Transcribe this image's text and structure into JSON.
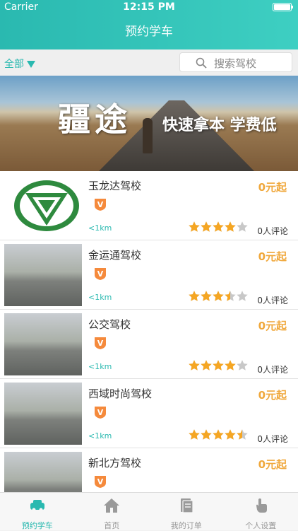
{
  "status_bar": {
    "carrier": "Carrier",
    "time": "12:15 PM"
  },
  "nav": {
    "title": "预约学车"
  },
  "filter": {
    "all_label": "全部"
  },
  "search": {
    "placeholder": "搜索驾校"
  },
  "banner": {
    "headline": "疆途",
    "slogan": "快速拿本 学费低"
  },
  "colors": {
    "accent": "#2ab9b0",
    "price": "#f0a83c",
    "star": "#f5a623",
    "star_empty": "#c8c8c8"
  },
  "schools": [
    {
      "name": "玉龙达驾校",
      "price": "0元起",
      "distance": "<1km",
      "rating": 4.0,
      "reviews": "0人评论",
      "thumb": "logo"
    },
    {
      "name": "金运通驾校",
      "price": "0元起",
      "distance": "<1km",
      "rating": 3.5,
      "reviews": "0人评论",
      "thumb": "photo"
    },
    {
      "name": "公交驾校",
      "price": "0元起",
      "distance": "<1km",
      "rating": 4.0,
      "reviews": "0人评论",
      "thumb": "photo"
    },
    {
      "name": "西域时尚驾校",
      "price": "0元起",
      "distance": "<1km",
      "rating": 4.5,
      "reviews": "0人评论",
      "thumb": "photo"
    },
    {
      "name": "新北方驾校",
      "price": "0元起",
      "distance": "",
      "rating": 0,
      "reviews": "",
      "thumb": "photo"
    }
  ],
  "tabs": [
    {
      "label": "预约学车",
      "icon": "car-icon",
      "active": true
    },
    {
      "label": "首页",
      "icon": "home-icon",
      "active": false
    },
    {
      "label": "我的订单",
      "icon": "orders-icon",
      "active": false
    },
    {
      "label": "个人设置",
      "icon": "hand-pointer-icon",
      "active": false
    }
  ]
}
